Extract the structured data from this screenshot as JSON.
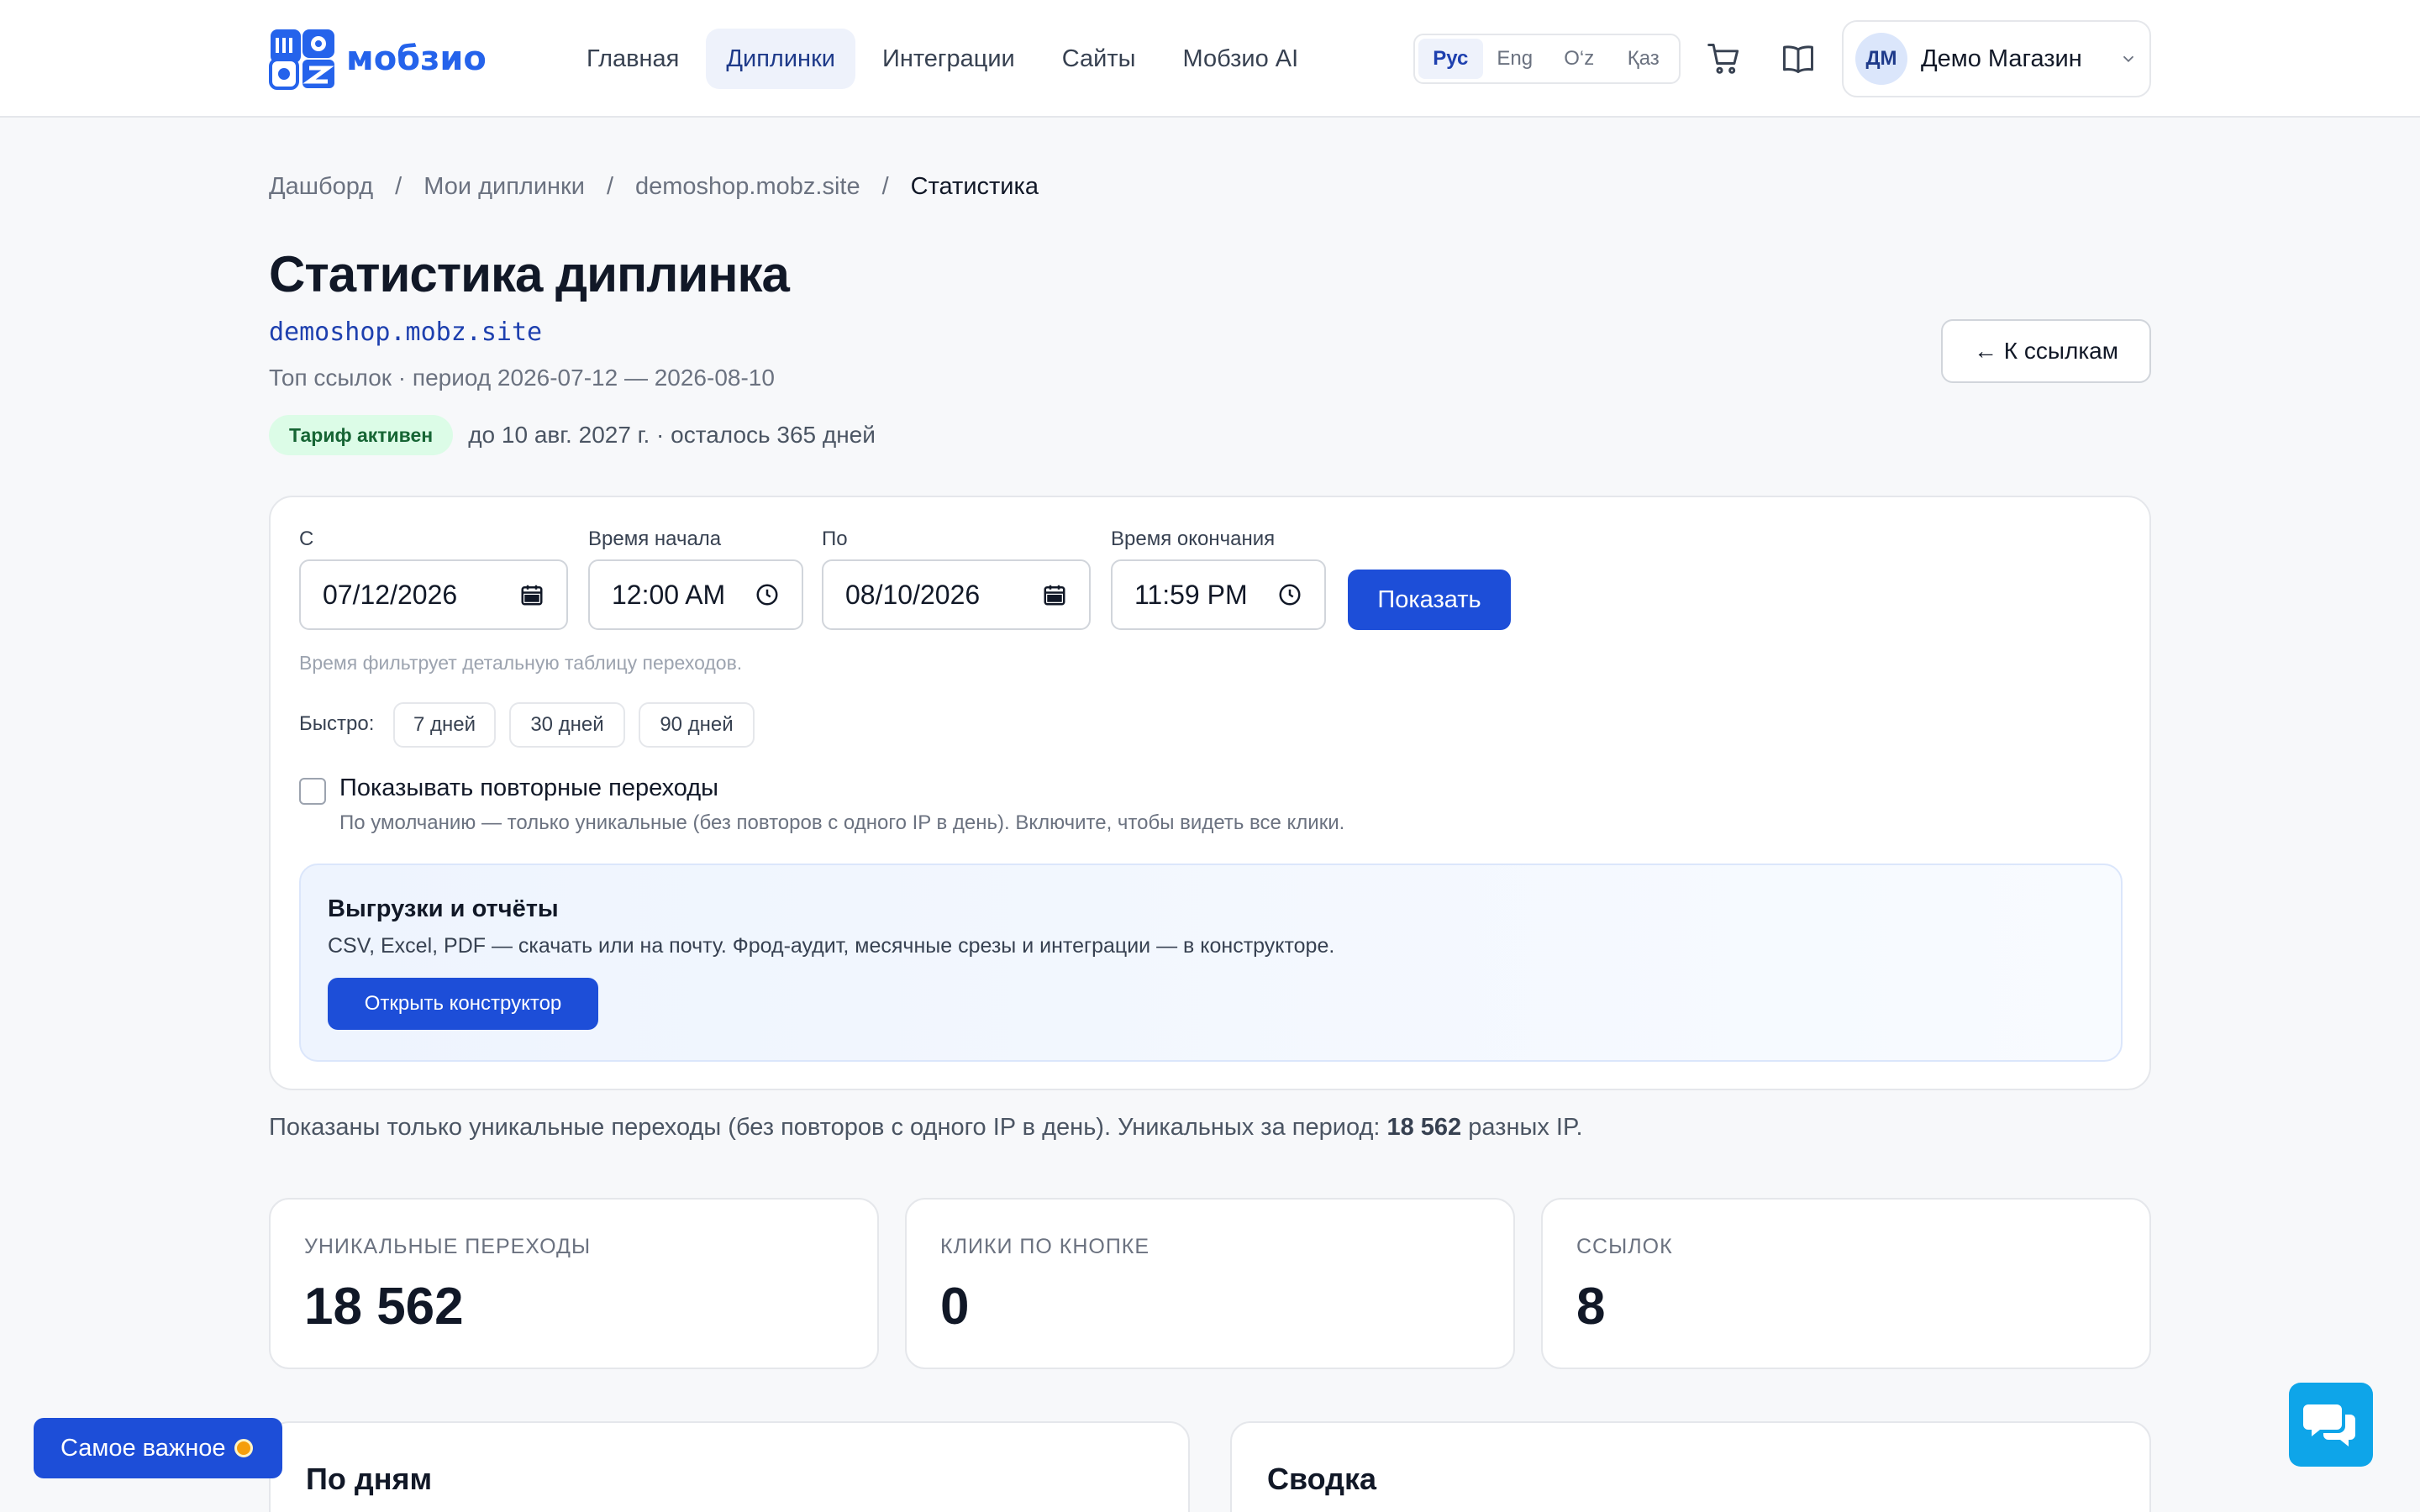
{
  "header": {
    "logo_text": "мобзио",
    "nav": [
      {
        "label": "Главная"
      },
      {
        "label": "Диплинки"
      },
      {
        "label": "Интеграции"
      },
      {
        "label": "Сайты"
      },
      {
        "label": "Мобзио AI"
      }
    ],
    "active_nav": "Диплинки",
    "languages": [
      "Рус",
      "Eng",
      "O‘z",
      "Қаз"
    ],
    "active_language": "Рус",
    "cart_icon": "cart-icon",
    "docs_icon": "book-icon",
    "user": {
      "initials": "ДМ",
      "name": "Демо Магазин"
    }
  },
  "breadcrumb": [
    "Дашборд",
    "Мои диплинки",
    "demoshop.mobz.site",
    "Статистика"
  ],
  "page": {
    "title": "Статистика диплинка",
    "domain": "demoshop.mobz.site",
    "subtitle": "Топ ссылок · период 2026-07-12 — 2026-08-10",
    "tariff_badge": "Тариф активен",
    "tariff_text": "до 10 авг. 2027 г. · осталось 365 дней",
    "back_button": "← К ссылкам"
  },
  "filter": {
    "from_label": "С",
    "from_value": "07/12/2026",
    "start_time_label": "Время начала",
    "start_time_value": "12:00 AM",
    "to_label": "По",
    "to_value": "08/10/2026",
    "end_time_label": "Время окончания",
    "end_time_value": "11:59 PM",
    "show_button": "Показать",
    "hint": "Время фильтрует детальную таблицу переходов.",
    "quick_label": "Быстро:",
    "quick_options": [
      "7 дней",
      "30 дней",
      "90 дней"
    ],
    "repeat_checkbox_label": "Показывать повторные переходы",
    "repeat_checked": false,
    "repeat_desc": "По умолчанию — только уникальные (без повторов с одного IP в день). Включите, чтобы видеть все клики."
  },
  "exports": {
    "title": "Выгрузки и отчёты",
    "desc": "CSV, Excel, PDF — скачать или на почту. Фрод-аудит, месячные срезы и интеграции — в конструкторе.",
    "button": "Открыть конструктор"
  },
  "note": {
    "prefix": "Показаны только уникальные переходы (без повторов с одного IP в день). Уникальных за период: ",
    "count": "18 562",
    "suffix": " разных IP."
  },
  "stats": [
    {
      "label": "УНИКАЛЬНЫЕ ПЕРЕХОДЫ",
      "value": "18 562"
    },
    {
      "label": "КЛИКИ ПО КНОПКЕ",
      "value": "0"
    },
    {
      "label": "ССЫЛОК",
      "value": "8"
    }
  ],
  "sections": [
    {
      "title": "По дням"
    },
    {
      "title": "Сводка"
    }
  ],
  "floating": {
    "important_button": "Самое важное",
    "chat_icon": "chat-icon"
  },
  "colors": {
    "accent": "#1d4ed8",
    "brand": "#2563eb",
    "badge_bg": "#dcfce7",
    "badge_text": "#166534",
    "chat": "#0ea5e9"
  }
}
